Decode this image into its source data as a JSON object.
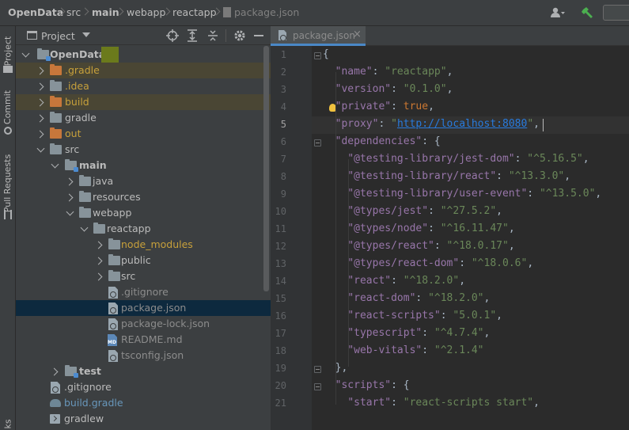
{
  "breadcrumb": [
    "OpenData",
    "src",
    "main",
    "webapp",
    "reactapp",
    "package.json"
  ],
  "left_tabs": {
    "project": "Project",
    "commit": "Commit",
    "pull_requests": "Pull Requests",
    "bottom": "ks"
  },
  "project_panel": {
    "title": "Project",
    "tree": [
      {
        "label": "OpenData",
        "color": "#bbbbbb",
        "bold": true
      },
      {
        "label": ".gradle",
        "color": "#c7a03b"
      },
      {
        "label": ".idea",
        "color": "#c7a03b"
      },
      {
        "label": "build",
        "color": "#c7a03b"
      },
      {
        "label": "gradle",
        "color": "#bbbbbb"
      },
      {
        "label": "out",
        "color": "#c7a03b"
      },
      {
        "label": "src",
        "color": "#bbbbbb"
      },
      {
        "label": "main",
        "color": "#bbbbbb",
        "bold": true
      },
      {
        "label": "java",
        "color": "#bbbbbb"
      },
      {
        "label": "resources",
        "color": "#bbbbbb"
      },
      {
        "label": "webapp",
        "color": "#bbbbbb"
      },
      {
        "label": "reactapp",
        "color": "#bbbbbb"
      },
      {
        "label": "node_modules",
        "color": "#c7a03b"
      },
      {
        "label": "public",
        "color": "#bbbbbb"
      },
      {
        "label": "src",
        "color": "#bbbbbb"
      },
      {
        "label": ".gitignore",
        "color": "#8c8c8c"
      },
      {
        "label": "package.json",
        "color": "#8c8c8c"
      },
      {
        "label": "package-lock.json",
        "color": "#8c8c8c"
      },
      {
        "label": "README.md",
        "color": "#8c8c8c"
      },
      {
        "label": "tsconfig.json",
        "color": "#8c8c8c"
      },
      {
        "label": "test",
        "color": "#bbbbbb",
        "bold": true
      },
      {
        "label": ".gitignore",
        "color": "#bbbbbb"
      },
      {
        "label": "build.gradle",
        "color": "#6897bb"
      },
      {
        "label": "gradlew",
        "color": "#bbbbbb"
      }
    ]
  },
  "editor": {
    "tab_label": "package.json",
    "current_line": 5,
    "line_numbers": [
      "1",
      "2",
      "3",
      "4",
      "5",
      "6",
      "7",
      "8",
      "9",
      "10",
      "11",
      "12",
      "13",
      "14",
      "15",
      "16",
      "17",
      "18",
      "19",
      "20",
      "21"
    ],
    "lines": [
      [
        [
          "p",
          "{"
        ]
      ],
      [
        [
          "p",
          "  "
        ],
        [
          "k",
          "\"name\""
        ],
        [
          "p",
          ": "
        ],
        [
          "s",
          "\"reactapp\""
        ],
        [
          "p",
          ","
        ]
      ],
      [
        [
          "p",
          "  "
        ],
        [
          "k",
          "\"version\""
        ],
        [
          "p",
          ": "
        ],
        [
          "s",
          "\"0.1.0\""
        ],
        [
          "p",
          ","
        ]
      ],
      [
        [
          "p",
          "  "
        ],
        [
          "k",
          "\"private\""
        ],
        [
          "p",
          ": "
        ],
        [
          "w",
          "true"
        ],
        [
          "p",
          ","
        ]
      ],
      [
        [
          "p",
          "  "
        ],
        [
          "k",
          "\"proxy\""
        ],
        [
          "p",
          ": "
        ],
        [
          "s",
          "\""
        ],
        [
          "u",
          "http://localhost:8080"
        ],
        [
          "s",
          "\""
        ],
        [
          "p",
          ","
        ]
      ],
      [
        [
          "p",
          "  "
        ],
        [
          "k",
          "\"dependencies\""
        ],
        [
          "p",
          ": {"
        ]
      ],
      [
        [
          "p",
          "    "
        ],
        [
          "k",
          "\"@testing-library/jest-dom\""
        ],
        [
          "p",
          ": "
        ],
        [
          "s",
          "\"^5.16.5\""
        ],
        [
          "p",
          ","
        ]
      ],
      [
        [
          "p",
          "    "
        ],
        [
          "k",
          "\"@testing-library/react\""
        ],
        [
          "p",
          ": "
        ],
        [
          "s",
          "\"^13.3.0\""
        ],
        [
          "p",
          ","
        ]
      ],
      [
        [
          "p",
          "    "
        ],
        [
          "k",
          "\"@testing-library/user-event\""
        ],
        [
          "p",
          ": "
        ],
        [
          "s",
          "\"^13.5.0\""
        ],
        [
          "p",
          ","
        ]
      ],
      [
        [
          "p",
          "    "
        ],
        [
          "k",
          "\"@types/jest\""
        ],
        [
          "p",
          ": "
        ],
        [
          "s",
          "\"^27.5.2\""
        ],
        [
          "p",
          ","
        ]
      ],
      [
        [
          "p",
          "    "
        ],
        [
          "k",
          "\"@types/node\""
        ],
        [
          "p",
          ": "
        ],
        [
          "s",
          "\"^16.11.47\""
        ],
        [
          "p",
          ","
        ]
      ],
      [
        [
          "p",
          "    "
        ],
        [
          "k",
          "\"@types/react\""
        ],
        [
          "p",
          ": "
        ],
        [
          "s",
          "\"^18.0.17\""
        ],
        [
          "p",
          ","
        ]
      ],
      [
        [
          "p",
          "    "
        ],
        [
          "k",
          "\"@types/react-dom\""
        ],
        [
          "p",
          ": "
        ],
        [
          "s",
          "\"^18.0.6\""
        ],
        [
          "p",
          ","
        ]
      ],
      [
        [
          "p",
          "    "
        ],
        [
          "k",
          "\"react\""
        ],
        [
          "p",
          ": "
        ],
        [
          "s",
          "\"^18.2.0\""
        ],
        [
          "p",
          ","
        ]
      ],
      [
        [
          "p",
          "    "
        ],
        [
          "k",
          "\"react-dom\""
        ],
        [
          "p",
          ": "
        ],
        [
          "s",
          "\"^18.2.0\""
        ],
        [
          "p",
          ","
        ]
      ],
      [
        [
          "p",
          "    "
        ],
        [
          "k",
          "\"react-scripts\""
        ],
        [
          "p",
          ": "
        ],
        [
          "s",
          "\"5.0.1\""
        ],
        [
          "p",
          ","
        ]
      ],
      [
        [
          "p",
          "    "
        ],
        [
          "k",
          "\"typescript\""
        ],
        [
          "p",
          ": "
        ],
        [
          "s",
          "\"^4.7.4\""
        ],
        [
          "p",
          ","
        ]
      ],
      [
        [
          "p",
          "    "
        ],
        [
          "k",
          "\"web-vitals\""
        ],
        [
          "p",
          ": "
        ],
        [
          "s",
          "\"^2.1.4\""
        ]
      ],
      [
        [
          "p",
          "  },"
        ]
      ],
      [
        [
          "p",
          "  "
        ],
        [
          "k",
          "\"scripts\""
        ],
        [
          "p",
          ": {"
        ]
      ],
      [
        [
          "p",
          "    "
        ],
        [
          "k",
          "\"start\""
        ],
        [
          "p",
          ": "
        ],
        [
          "s",
          "\"react-scripts start\""
        ],
        [
          "p",
          ","
        ]
      ]
    ]
  },
  "colors": {
    "selection": "#0d293e",
    "excluded_row": "#4a4634",
    "accent_build": "#4caf50"
  }
}
